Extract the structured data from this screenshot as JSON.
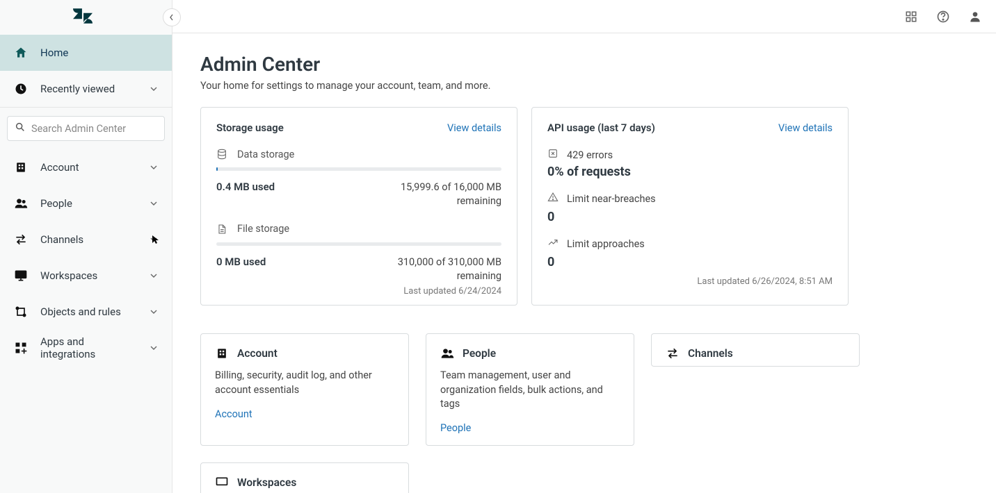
{
  "sidebar": {
    "search_placeholder": "Search Admin Center",
    "primary": {
      "home": "Home",
      "recent": "Recently viewed"
    },
    "sections": [
      {
        "label": "Account"
      },
      {
        "label": "People"
      },
      {
        "label": "Channels"
      },
      {
        "label": "Workspaces"
      },
      {
        "label": "Objects and rules"
      },
      {
        "label": "Apps and integrations"
      }
    ]
  },
  "page": {
    "title": "Admin Center",
    "subtitle": "Your home for settings to manage your account, team, and more."
  },
  "storage_card": {
    "title": "Storage usage",
    "view_details": "View details",
    "data_label": "Data storage",
    "data_used": "0.4 MB used",
    "data_remaining_line1": "15,999.6 of 16,000 MB",
    "data_remaining_line2": "remaining",
    "file_label": "File storage",
    "file_used": "0 MB used",
    "file_remaining_line1": "310,000 of 310,000 MB",
    "file_remaining_line2": "remaining",
    "last_updated": "Last updated 6/24/2024"
  },
  "api_card": {
    "title": "API usage (last 7 days)",
    "view_details": "View details",
    "errors_label": "429 errors",
    "errors_value": "0% of requests",
    "breaches_label": "Limit near-breaches",
    "breaches_value": "0",
    "approaches_label": "Limit approaches",
    "approaches_value": "0",
    "last_updated": "Last updated 6/26/2024, 8:51 AM"
  },
  "tiles": {
    "account": {
      "title": "Account",
      "desc": "Billing, security, audit log, and other account essentials",
      "link": "Account"
    },
    "people": {
      "title": "People",
      "desc": "Team management, user and organization fields, bulk actions, and tags",
      "link": "People"
    },
    "channels": {
      "title": "Channels"
    },
    "workspaces": {
      "title": "Workspaces"
    }
  }
}
